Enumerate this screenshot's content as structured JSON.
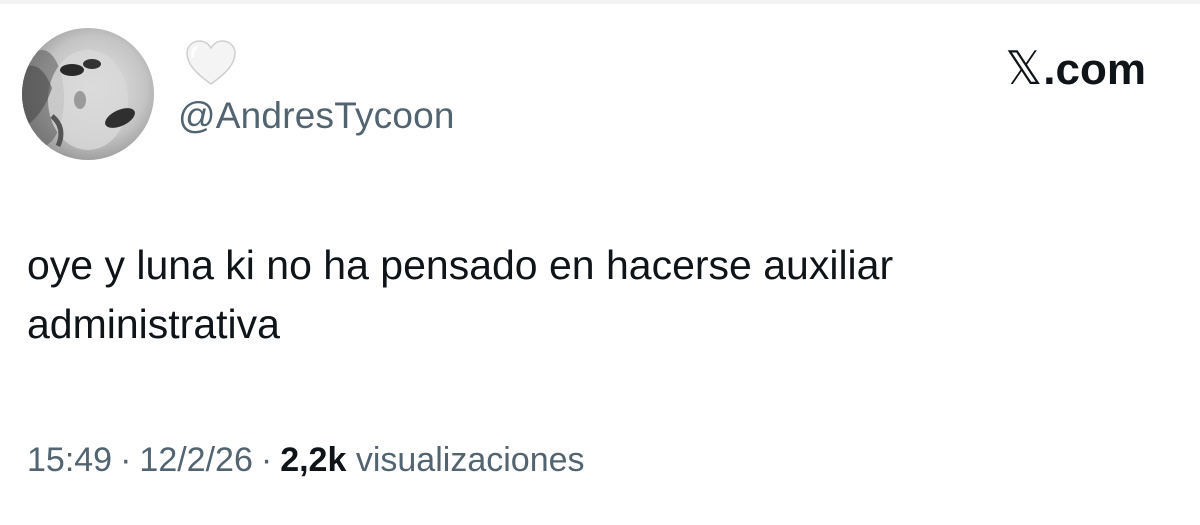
{
  "author": {
    "handle": "@AndresTycoon",
    "avatar_icon": "profile-photo",
    "badge_icon": "white-heart-icon"
  },
  "brand": {
    "x_glyph": "𝕏",
    "suffix": ".com"
  },
  "tweet": {
    "text": "oye y luna ki no ha pensado en hacerse auxiliar administrativa"
  },
  "meta": {
    "time": "15:49",
    "separator": "·",
    "date": "12/2/26",
    "views_count": "2,2k",
    "views_label": "visualizaciones"
  },
  "colors": {
    "text_primary": "#0f1419",
    "text_secondary": "#536471",
    "background": "#ffffff"
  }
}
